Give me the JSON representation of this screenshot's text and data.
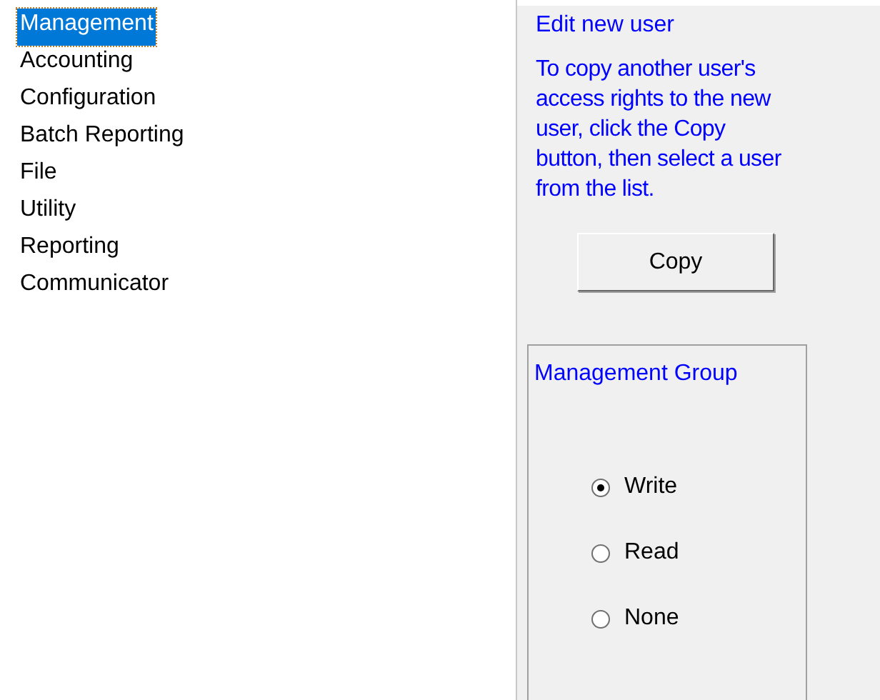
{
  "menu_list": [
    {
      "label": "Management",
      "selected": true
    },
    {
      "label": "Accounting",
      "selected": false
    },
    {
      "label": "Configuration",
      "selected": false
    },
    {
      "label": "Batch Reporting",
      "selected": false
    },
    {
      "label": "File",
      "selected": false
    },
    {
      "label": "Utility",
      "selected": false
    },
    {
      "label": "Reporting",
      "selected": false
    },
    {
      "label": "Communicator",
      "selected": false
    }
  ],
  "panel": {
    "title": "Edit new user",
    "instructions": "To copy another user's access rights to the new user, click the Copy button, then select a user from the list.",
    "copy_button": "Copy",
    "group": {
      "title": "Management Group",
      "options": [
        {
          "label": "Write",
          "selected": true
        },
        {
          "label": "Read",
          "selected": false
        },
        {
          "label": "None",
          "selected": false
        }
      ]
    }
  }
}
